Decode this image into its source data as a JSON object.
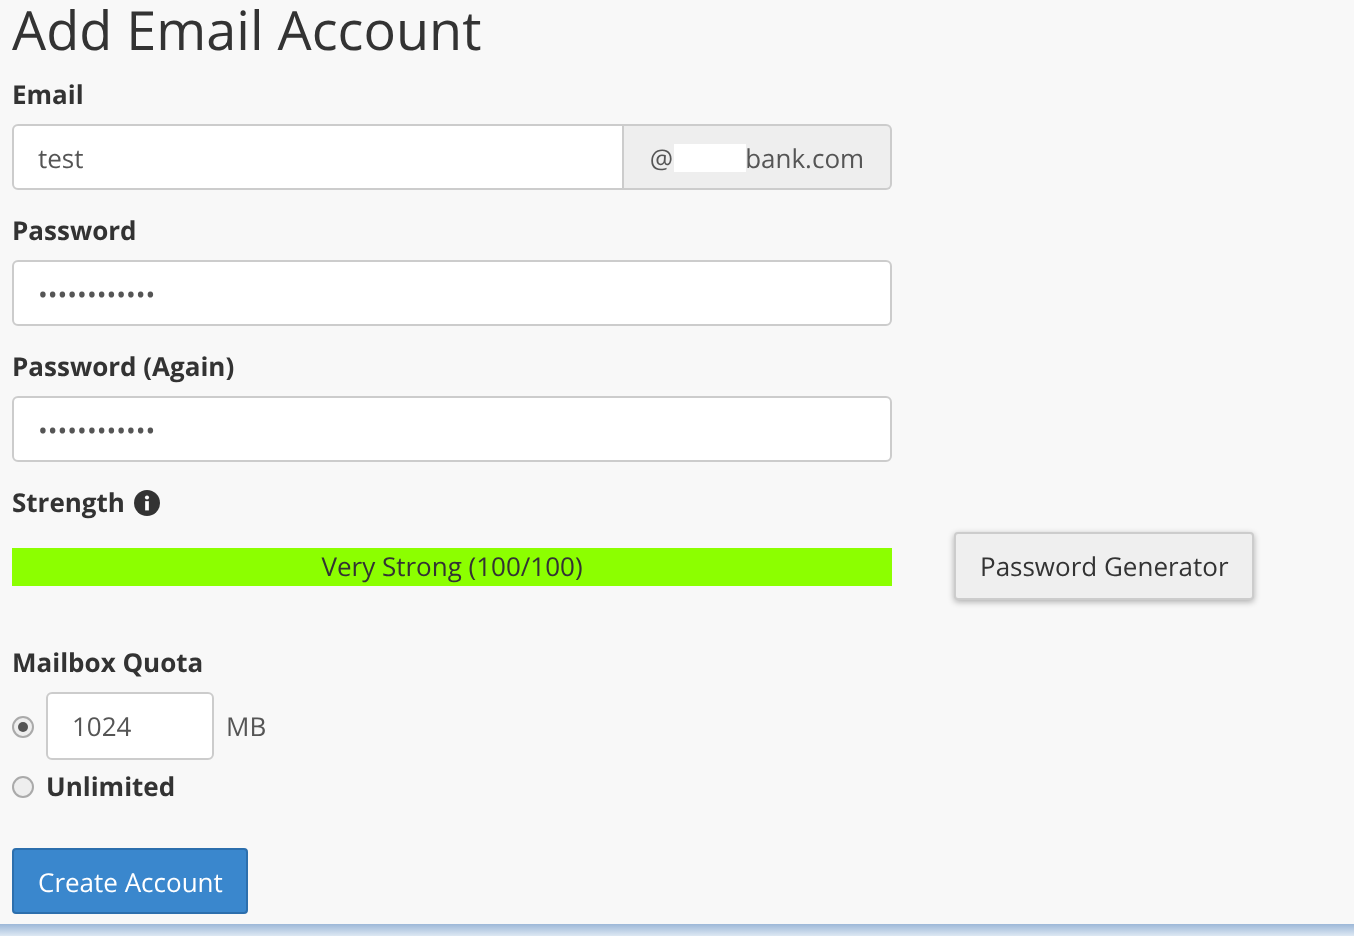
{
  "title": "Add Email Account",
  "email": {
    "label": "Email",
    "value": "test",
    "at": "@",
    "domain": "bank.com"
  },
  "password": {
    "label": "Password",
    "value": "••••••••••••"
  },
  "password_again": {
    "label": "Password (Again)",
    "value": "••••••••••••"
  },
  "strength": {
    "label": "Strength",
    "level": 1,
    "reading": "Very Strong (100/100)"
  },
  "generator_button": "Password Generator",
  "quota": {
    "label": "Mailbox Quota",
    "options": [
      {
        "kind": "value",
        "selected": true,
        "value": "1024",
        "unit": "MB"
      },
      {
        "kind": "unlimited",
        "selected": false,
        "label": "Unlimited"
      }
    ]
  },
  "submit_button": "Create Account"
}
